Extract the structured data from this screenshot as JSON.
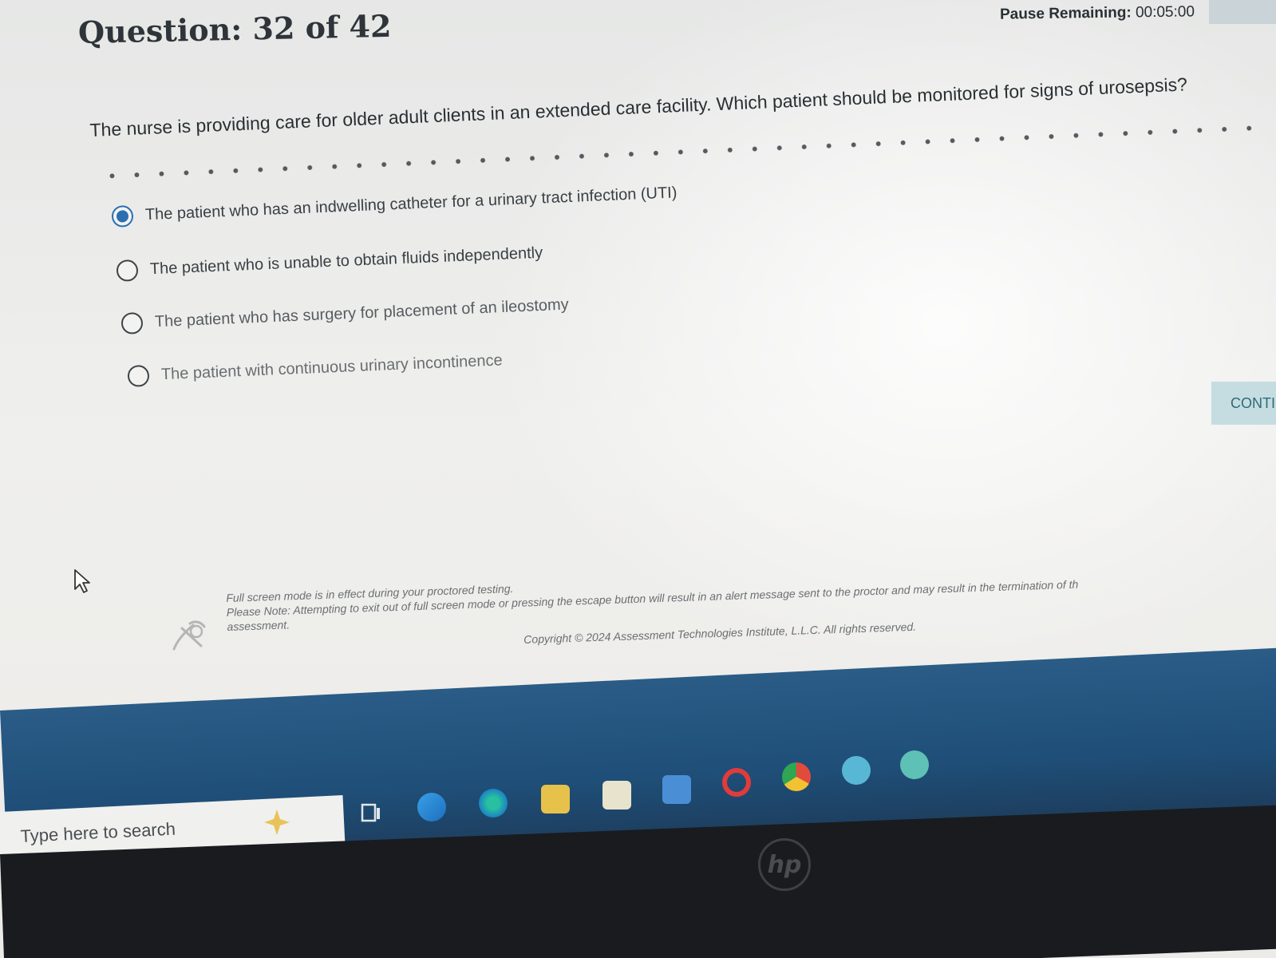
{
  "header": {
    "question_label": "Question: 32 of 42",
    "pause_label": "Pause Remaining:",
    "pause_time": "00:05:00"
  },
  "question": {
    "stem": "The nurse is providing care for older adult clients in an extended care facility. Which patient should be monitored for signs of urosepsis?",
    "options": [
      {
        "label": "The patient who has an indwelling catheter for a urinary tract infection (UTI)",
        "selected": true
      },
      {
        "label": "The patient who is unable to obtain fluids independently",
        "selected": false
      },
      {
        "label": "The patient who has surgery for placement of an ileostomy",
        "selected": false
      },
      {
        "label": "The patient with continuous urinary incontinence",
        "selected": false
      }
    ]
  },
  "actions": {
    "continue_label": "CONTI"
  },
  "footer": {
    "line1": "Full screen mode is in effect during your proctored testing.",
    "line2": "Please Note: Attempting to exit out of full screen mode or pressing the escape button will result in an alert message sent to the proctor and may result in the termination of th",
    "line3": "assessment.",
    "copyright": "Copyright © 2024 Assessment Technologies Institute, L.L.C. All rights reserved."
  },
  "taskbar": {
    "search_placeholder": "Type here to search",
    "icons": [
      "task-view-icon",
      "edge-icon",
      "edge-alt-icon",
      "file-explorer-icon",
      "store-icon",
      "mail-icon",
      "opera-icon",
      "chrome-icon",
      "app-icon-r",
      "app-icon-r-2"
    ]
  },
  "brand": {
    "device_logo": "hp"
  },
  "colors": {
    "selected_radio": "#2b6fb2",
    "continue_bg": "#c5dde1",
    "taskbar": "#1f4f79"
  }
}
